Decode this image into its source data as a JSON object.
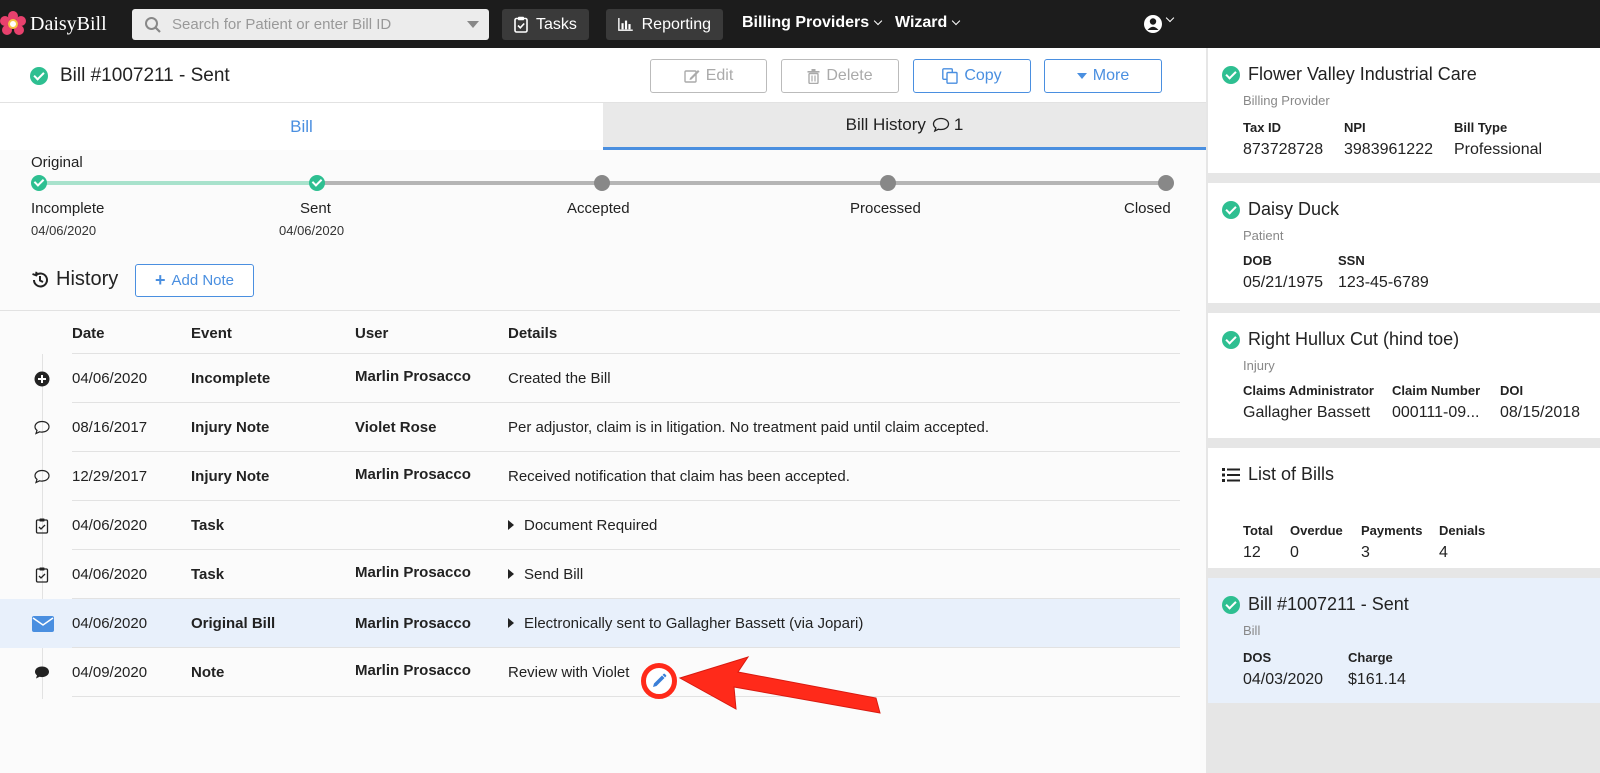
{
  "app": {
    "logo_text": "DaisyBill"
  },
  "topnav": {
    "search_placeholder": "Search for Patient or enter Bill ID",
    "tasks": "Tasks",
    "reporting": "Reporting",
    "billing_providers": "Billing Providers",
    "wizard": "Wizard"
  },
  "bill": {
    "title": "Bill #1007211 - Sent",
    "actions": {
      "edit": "Edit",
      "delete": "Delete",
      "copy": "Copy",
      "more": "More"
    }
  },
  "tabs": {
    "bill": "Bill",
    "history": "Bill History",
    "history_count": "1"
  },
  "progress": {
    "label": "Original",
    "stages": [
      {
        "name": "Incomplete",
        "date": "04/06/2020",
        "done": true
      },
      {
        "name": "Sent",
        "date": "04/06/2020",
        "done": true
      },
      {
        "name": "Accepted",
        "date": "",
        "done": false
      },
      {
        "name": "Processed",
        "date": "",
        "done": false
      },
      {
        "name": "Closed",
        "date": "",
        "done": false
      }
    ]
  },
  "history": {
    "title": "History",
    "add_note": "Add Note",
    "columns": [
      "Date",
      "Event",
      "User",
      "Details"
    ],
    "rows": [
      {
        "icon": "plus-circle-icon",
        "date": "04/06/2020",
        "event": "Incomplete",
        "user": "Marlin Prosacco",
        "details": "Created the Bill",
        "expandable": false
      },
      {
        "icon": "comment-icon",
        "date": "08/16/2017",
        "event": "Injury Note",
        "user": "Violet Rose",
        "details": "Per adjustor, claim is in litigation. No treatment paid until claim accepted.",
        "expandable": false
      },
      {
        "icon": "comment-icon",
        "date": "12/29/2017",
        "event": "Injury Note",
        "user": "Marlin Prosacco",
        "details": "Received notification that claim has been accepted.",
        "expandable": false
      },
      {
        "icon": "task-icon",
        "date": "04/06/2020",
        "event": "Task",
        "user": "",
        "details": "Document Required",
        "expandable": true
      },
      {
        "icon": "task-icon",
        "date": "04/06/2020",
        "event": "Task",
        "user": "Marlin Prosacco",
        "details": "Send Bill",
        "expandable": true
      },
      {
        "icon": "envelope-icon",
        "date": "04/06/2020",
        "event": "Original Bill",
        "user": "Marlin Prosacco",
        "details": "Electronically sent to Gallagher Bassett (via Jopari)",
        "expandable": true
      },
      {
        "icon": "comment-filled-icon",
        "date": "04/09/2020",
        "event": "Note",
        "user": "Marlin Prosacco",
        "details": "Review with Violet",
        "expandable": false
      }
    ]
  },
  "sidebar": {
    "provider": {
      "name": "Flower Valley Industrial Care",
      "type": "Billing Provider",
      "fields": [
        {
          "label": "Tax ID",
          "value": "873728728"
        },
        {
          "label": "NPI",
          "value": "3983961222"
        },
        {
          "label": "Bill Type",
          "value": "Professional"
        }
      ]
    },
    "patient": {
      "name": "Daisy Duck",
      "type": "Patient",
      "fields": [
        {
          "label": "DOB",
          "value": "05/21/1975"
        },
        {
          "label": "SSN",
          "value": "123-45-6789"
        }
      ]
    },
    "injury": {
      "name": "Right Hullux Cut (hind toe)",
      "type": "Injury",
      "fields": [
        {
          "label": "Claims Administrator",
          "value": "Gallagher Bassett"
        },
        {
          "label": "Claim Number",
          "value": "000111-09..."
        },
        {
          "label": "DOI",
          "value": "08/15/2018"
        }
      ]
    },
    "bills": {
      "title": "List of Bills",
      "fields": [
        {
          "label": "Total",
          "value": "12"
        },
        {
          "label": "Overdue",
          "value": "0"
        },
        {
          "label": "Payments",
          "value": "3"
        },
        {
          "label": "Denials",
          "value": "4"
        }
      ]
    },
    "current_bill": {
      "name": "Bill #1007211 - Sent",
      "type": "Bill",
      "fields": [
        {
          "label": "DOS",
          "value": "04/03/2020"
        },
        {
          "label": "Charge",
          "value": "$161.14"
        }
      ]
    }
  },
  "colors": {
    "accent": "#4a8fe0",
    "success": "#2ebf91",
    "annotation": "#ff2a1a",
    "nav_bg": "#1c1c1c"
  }
}
